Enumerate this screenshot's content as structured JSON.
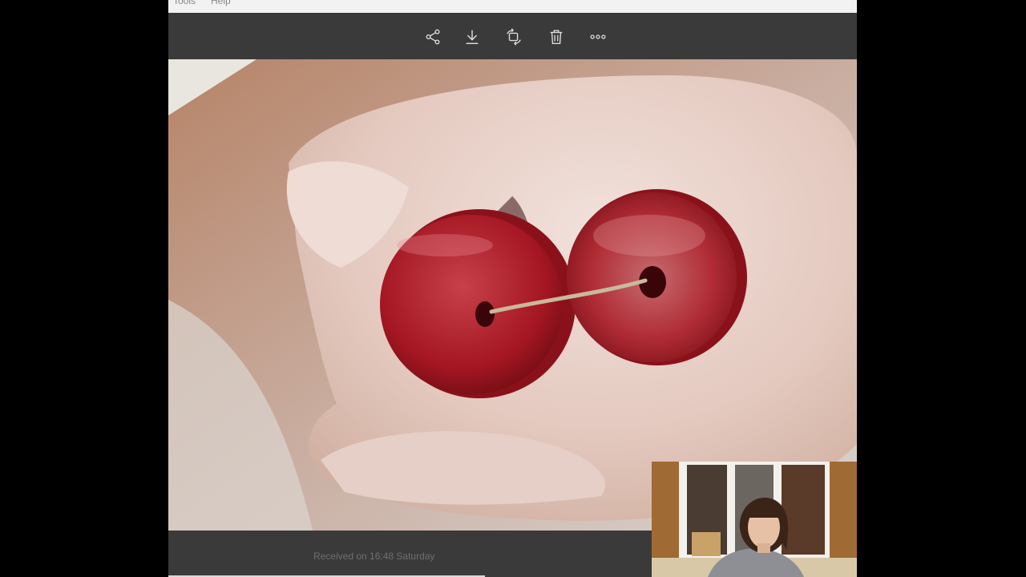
{
  "menu": {
    "items": [
      "Tools",
      "Help"
    ]
  },
  "toolbar": {
    "buttons": [
      {
        "icon": "share-icon"
      },
      {
        "icon": "download-icon"
      },
      {
        "icon": "rotate-icon"
      },
      {
        "icon": "delete-icon"
      },
      {
        "icon": "more-icon"
      }
    ]
  },
  "footer": {
    "received": "Received on 16:48 Saturday"
  },
  "colors": {
    "toolbar_bg": "#3a3a3a",
    "icon": "#dcdcdc",
    "bead_red": "#b31621"
  }
}
